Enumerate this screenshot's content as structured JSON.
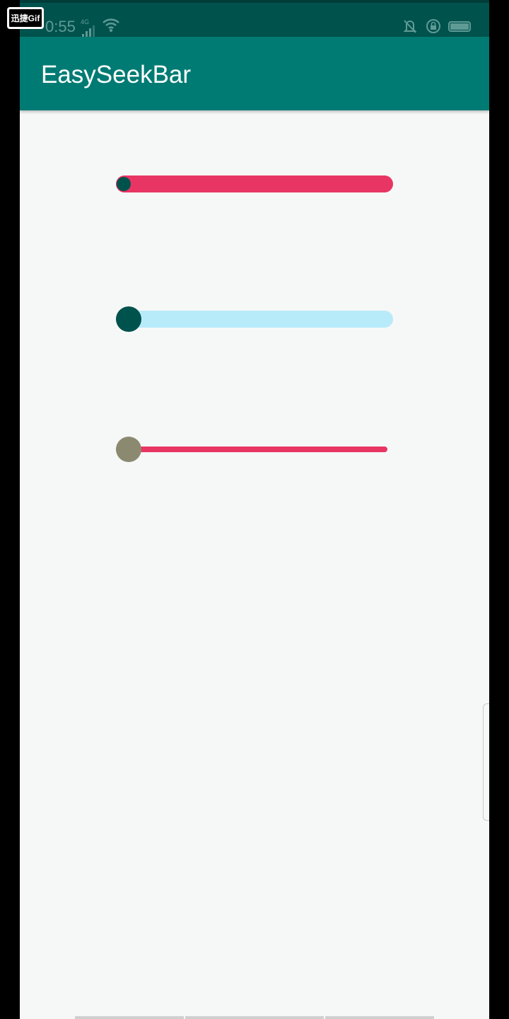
{
  "status_bar": {
    "time": "0:55",
    "network": "4G",
    "icons": [
      "signal-icon",
      "wifi-icon",
      "vibrate-icon",
      "rotation-lock-icon",
      "battery-icon"
    ]
  },
  "overlay_badge": "迅捷Gif",
  "app_bar": {
    "title": "EasySeekBar",
    "color": "#007b74"
  },
  "seekbars": [
    {
      "progress": 0,
      "track_color": "#e83563",
      "thumb_color": "#00524d"
    },
    {
      "progress": 0,
      "track_color": "#b7ebfa",
      "thumb_color": "#00524d"
    },
    {
      "progress": 0,
      "track_color": "#e83563",
      "thumb_color": "#8b8a71"
    }
  ]
}
